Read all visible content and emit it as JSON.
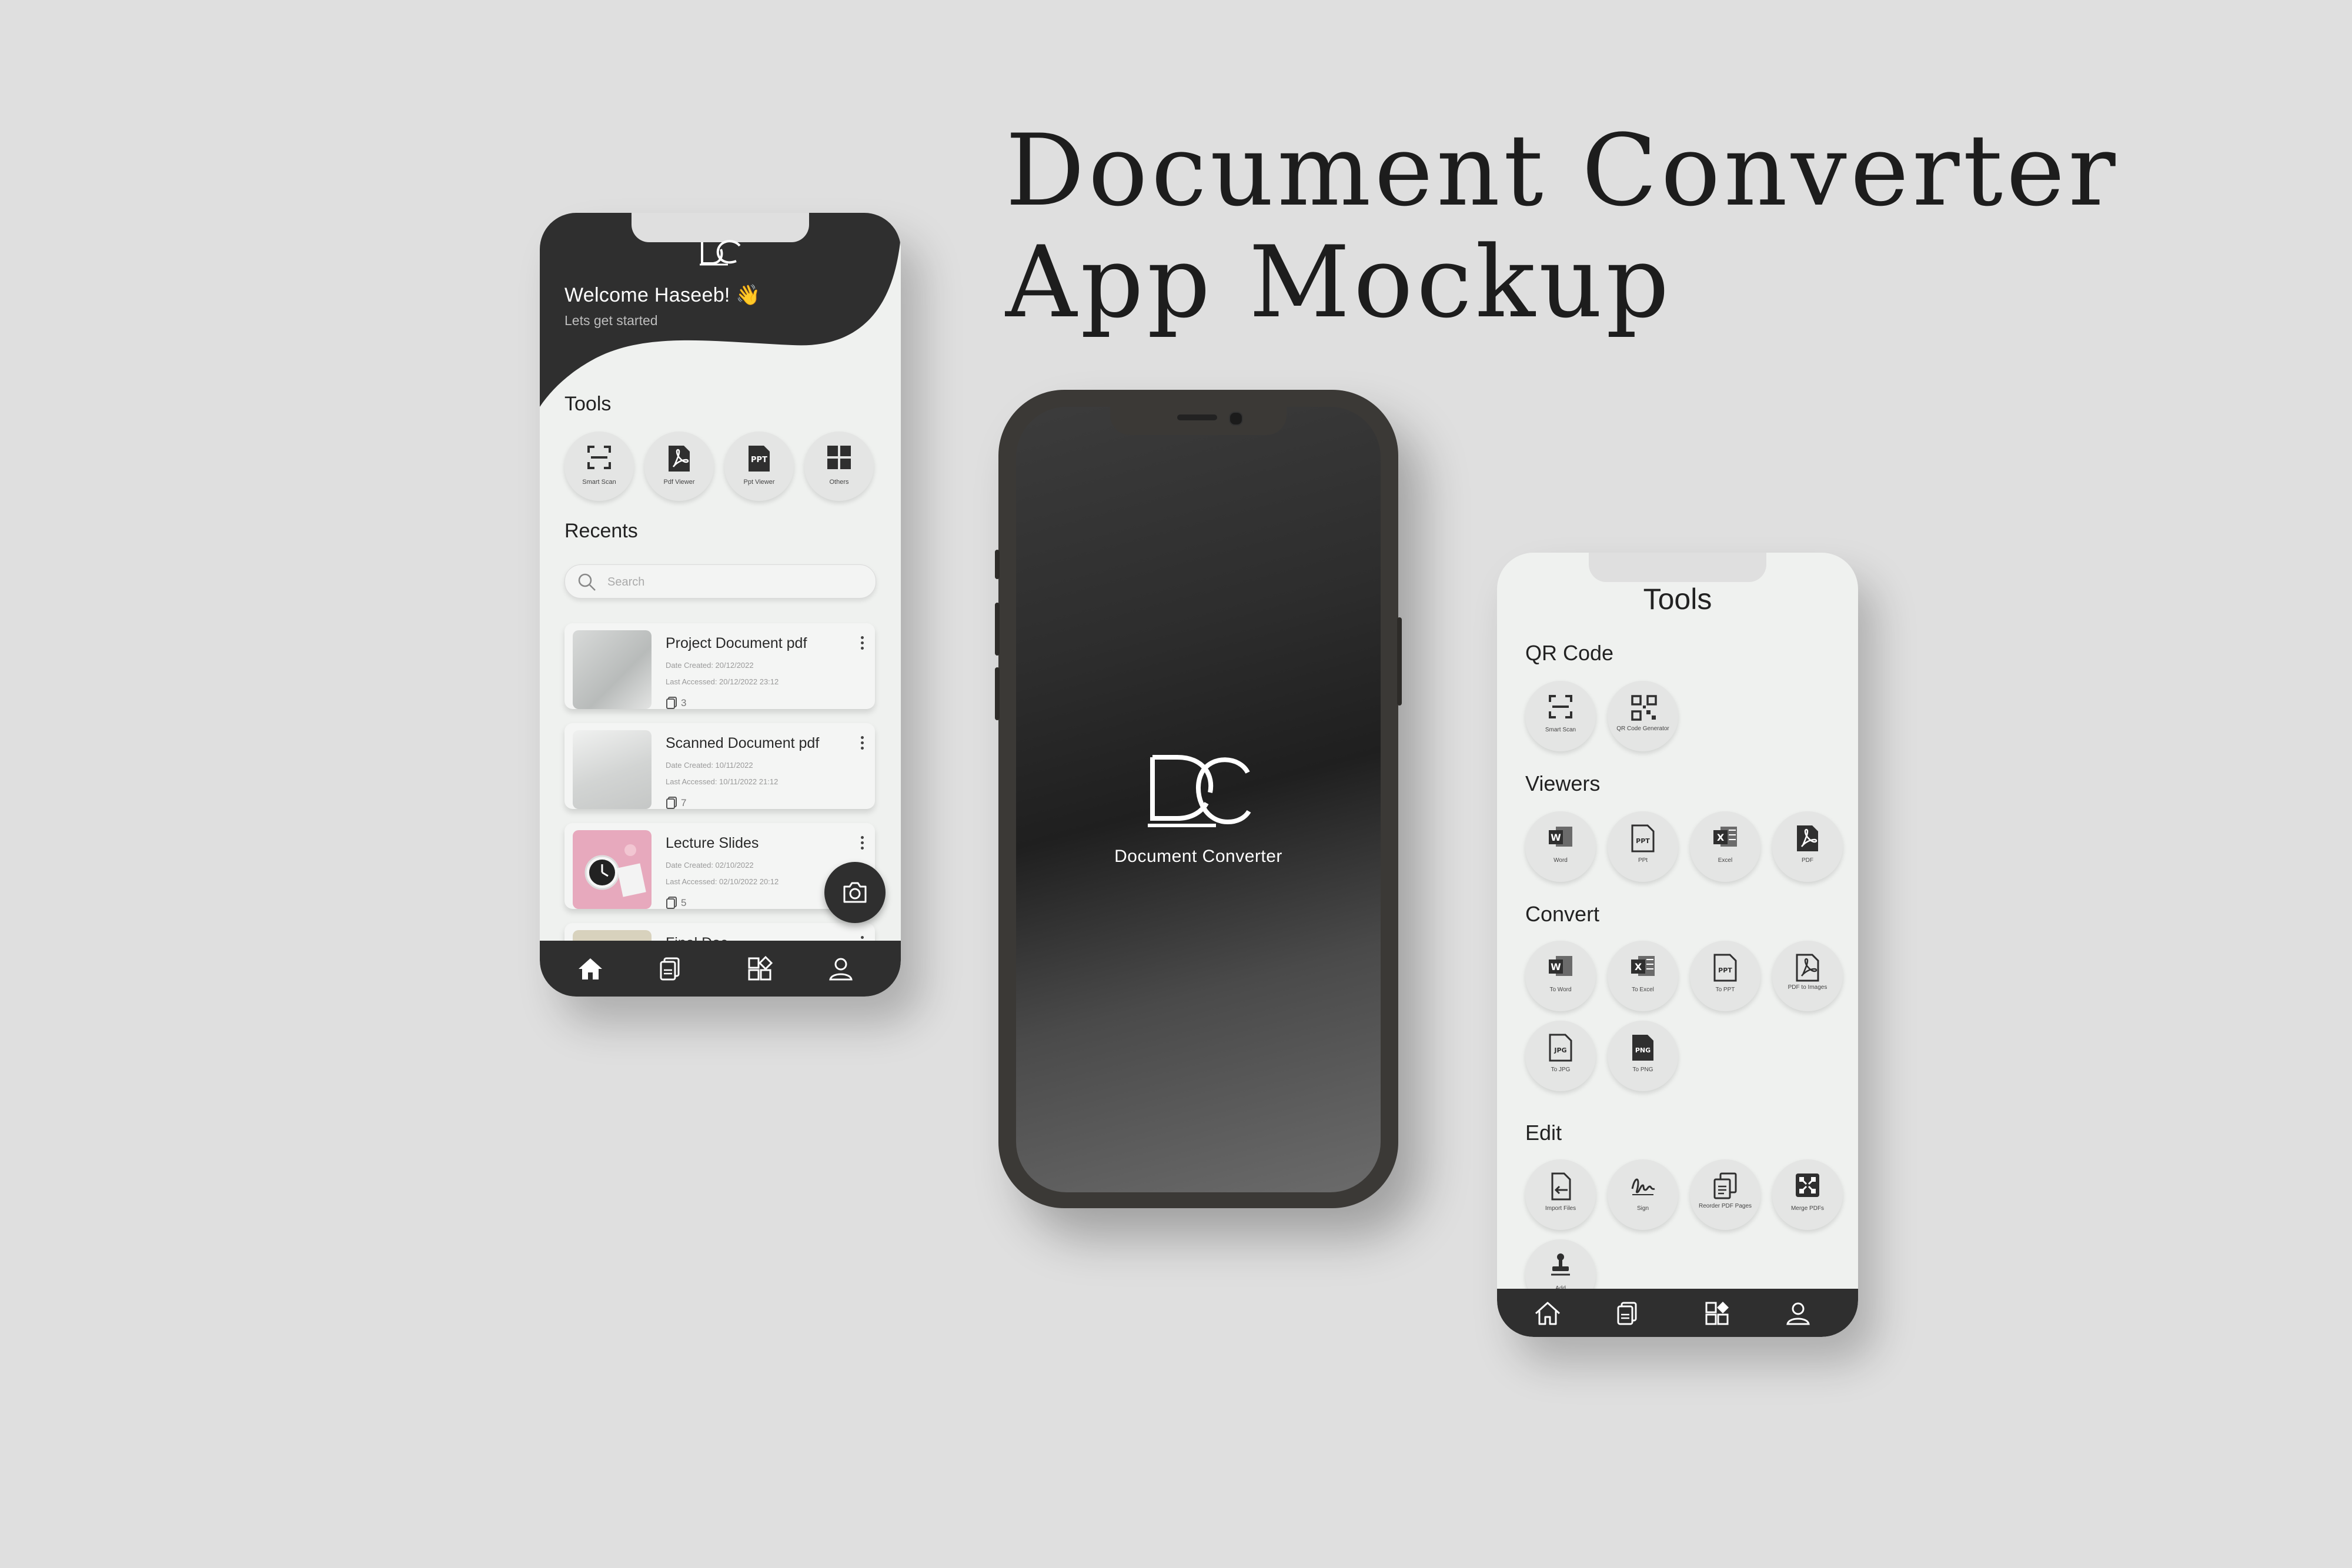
{
  "title": {
    "line1": "Document Converter",
    "line2": "App Mockup"
  },
  "home": {
    "welcome": "Welcome Haseeb! 👋",
    "subtitle": "Lets get started",
    "tools_heading": "Tools",
    "tools": [
      {
        "label": "Smart Scan",
        "icon": "scan-icon"
      },
      {
        "label": "Pdf Viewer",
        "icon": "pdf-icon"
      },
      {
        "label": "Ppt Viewer",
        "icon": "ppt-icon"
      },
      {
        "label": "Others",
        "icon": "grid-icon"
      }
    ],
    "recents_heading": "Recents",
    "search_placeholder": "Search",
    "recents": [
      {
        "title": "Project Document pdf",
        "created": "Date Created: 20/12/2022",
        "accessed": "Last Accessed: 20/12/2022 23:12",
        "pages": "3"
      },
      {
        "title": "Scanned Document pdf",
        "created": "Date Created: 10/11/2022",
        "accessed": "Last Accessed: 10/11/2022 21:12",
        "pages": "7"
      },
      {
        "title": "Lecture Slides",
        "created": "Date Created: 02/10/2022",
        "accessed": "Last Accessed: 02/10/2022 20:12",
        "pages": "5"
      },
      {
        "title": "Final Doc",
        "created": "",
        "accessed": "",
        "pages": ""
      }
    ],
    "nav": [
      "home-icon",
      "documents-icon",
      "tools-icon",
      "profile-icon"
    ]
  },
  "splash": {
    "app_name": "Document Converter",
    "logo": "DC"
  },
  "tools_screen": {
    "title": "Tools",
    "sections": [
      {
        "name": "QR Code",
        "items": [
          {
            "label": "Smart Scan",
            "icon": "scan-icon"
          },
          {
            "label": "QR Code Generator",
            "icon": "qr-icon"
          }
        ]
      },
      {
        "name": "Viewers",
        "items": [
          {
            "label": "Word",
            "icon": "word-icon"
          },
          {
            "label": "PPt",
            "icon": "ppt-icon"
          },
          {
            "label": "Excel",
            "icon": "excel-icon"
          },
          {
            "label": "PDF",
            "icon": "pdf-icon"
          }
        ]
      },
      {
        "name": "Convert",
        "items": [
          {
            "label": "To Word",
            "icon": "word-icon"
          },
          {
            "label": "To Excel",
            "icon": "excel-icon"
          },
          {
            "label": "To PPT",
            "icon": "ppt-icon"
          },
          {
            "label": "PDF to Images",
            "icon": "pdf-icon"
          },
          {
            "label": "To JPG",
            "icon": "jpg-icon"
          },
          {
            "label": "To PNG",
            "icon": "png-icon"
          }
        ]
      },
      {
        "name": "Edit",
        "items": [
          {
            "label": "Import Files",
            "icon": "import-icon"
          },
          {
            "label": "Sign",
            "icon": "signature-icon"
          },
          {
            "label": "Reorder PDF Pages",
            "icon": "reorder-icon"
          },
          {
            "label": "Merge PDFs",
            "icon": "merge-icon"
          },
          {
            "label": "Add",
            "icon": "stamp-icon"
          }
        ]
      }
    ]
  }
}
